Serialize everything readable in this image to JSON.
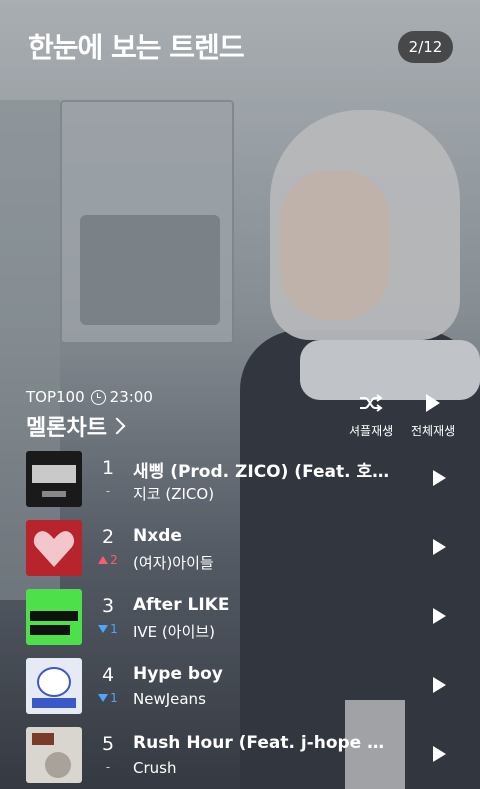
{
  "header": {
    "title": "한눈에 보는 트렌드",
    "page_indicator": "2/12"
  },
  "chart": {
    "label": "TOP100",
    "time": "23:00",
    "name": "멜론차트",
    "shuffle_label": "셔플재생",
    "play_all_label": "전체재생"
  },
  "songs": [
    {
      "rank": "1",
      "title": "새삥 (Prod. ZICO) (Feat. 호…",
      "artist": "지코 (ZICO)",
      "change": "-",
      "change_type": "same"
    },
    {
      "rank": "2",
      "title": "Nxde",
      "artist": "(여자)아이들",
      "change": "2",
      "change_type": "up"
    },
    {
      "rank": "3",
      "title": "After LIKE",
      "artist": "IVE (아이브)",
      "change": "1",
      "change_type": "down"
    },
    {
      "rank": "4",
      "title": "Hype boy",
      "artist": "NewJeans",
      "change": "1",
      "change_type": "down"
    },
    {
      "rank": "5",
      "title": "Rush Hour (Feat. j-hope o...",
      "artist": "Crush",
      "change": "-",
      "change_type": "same"
    }
  ],
  "colors": {
    "rank_up": "#ff5a73",
    "rank_down": "#4aa6ff"
  }
}
